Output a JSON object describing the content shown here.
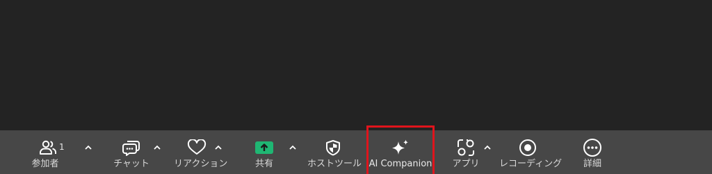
{
  "toolbar": {
    "participants": {
      "label": "参加者",
      "count": "1",
      "icon": "participants-icon"
    },
    "chat": {
      "label": "チャット",
      "icon": "chat-icon"
    },
    "reactions": {
      "label": "リアクション",
      "icon": "heart-icon"
    },
    "share": {
      "label": "共有",
      "icon": "share-screen-icon",
      "color": "#1fb673"
    },
    "host_tools": {
      "label": "ホストツール",
      "icon": "shield-icon"
    },
    "ai_companion": {
      "label": "AI Companion",
      "icon": "sparkle-icon"
    },
    "apps": {
      "label": "アプリ",
      "icon": "apps-icon"
    },
    "recording": {
      "label": "レコーディング",
      "icon": "record-icon"
    },
    "more": {
      "label": "詳細",
      "icon": "more-icon"
    }
  },
  "colors": {
    "background": "#232323",
    "toolbar": "#474747",
    "highlight": "#e0141c",
    "icon": "#ffffff",
    "label": "#d9d9d9"
  }
}
